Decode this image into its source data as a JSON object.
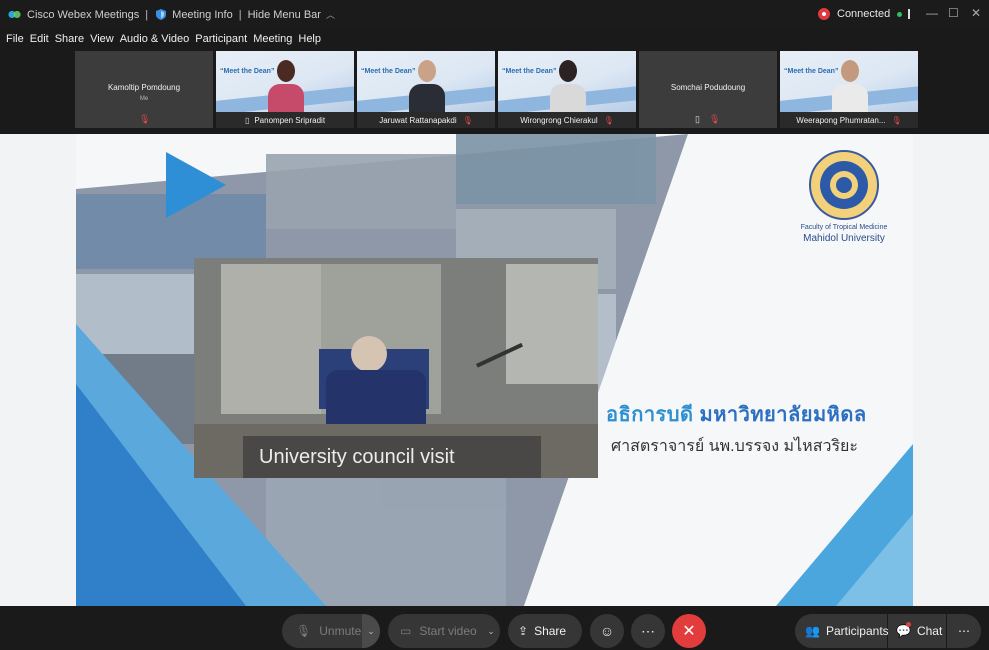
{
  "titlebar": {
    "app_name": "Cisco Webex Meetings",
    "meeting_info": "Meeting Info",
    "hide_menu": "Hide Menu Bar",
    "status": "Connected"
  },
  "menu": [
    "File",
    "Edit",
    "Share",
    "View",
    "Audio & Video",
    "Participant",
    "Meeting",
    "Help"
  ],
  "thumbnails": [
    {
      "name": "Kamoltip Pomdoung",
      "sub": "Me",
      "has_video": false
    },
    {
      "name": "Panompen Sripradit",
      "has_video": true,
      "banner": "“Meet the Dean”"
    },
    {
      "name": "Jaruwat Rattanapakdi",
      "has_video": true,
      "banner": "“Meet the Dean”"
    },
    {
      "name": "Wirongrong Chierakul",
      "has_video": true,
      "banner": "“Meet the Dean”"
    },
    {
      "name": "Somchai Podudoung",
      "has_video": false
    },
    {
      "name": "Weerapong Phumratan...",
      "has_video": true,
      "banner": "“Meet the Dean”"
    }
  ],
  "slide": {
    "faculty": "Faculty of Tropical Medicine",
    "university": "Mahidol University",
    "thai_line1_part1": "อธิการบดี ",
    "thai_line1_part2": "มหาวิทยาลัยมหิดล",
    "thai_line2": "ศาสตราจารย์ นพ.บรรจง มไหสวริยะ",
    "caption": "University council visit"
  },
  "toolbar": {
    "unmute": "Unmute",
    "start_video": "Start video",
    "share": "Share",
    "participants": "Participants",
    "chat": "Chat"
  },
  "colors": {
    "accent_blue": "#2e90d0",
    "end_red": "#e23c3c",
    "status_green": "#2fbf61"
  }
}
